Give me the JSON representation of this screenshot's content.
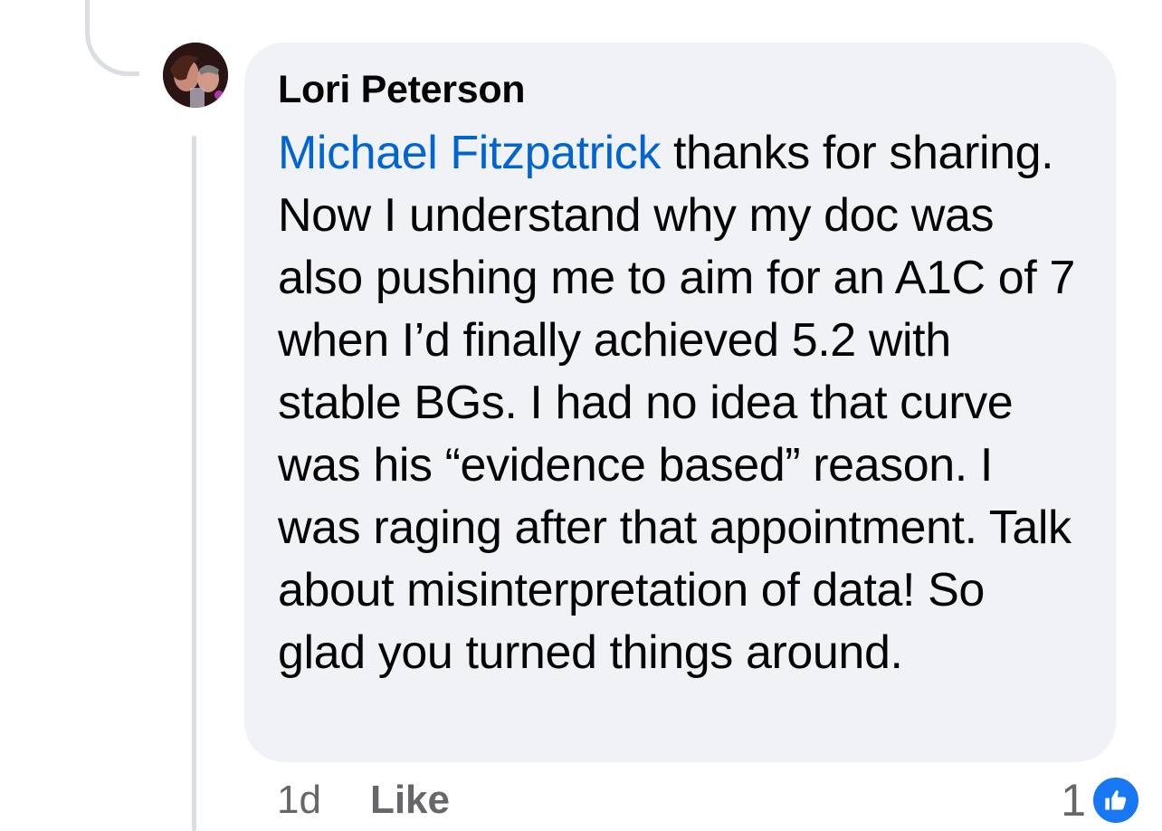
{
  "comment": {
    "author": "Lori Peterson",
    "mention": "Michael Fitzpatrick",
    "text": " thanks for sharing. Now I understand why my doc was also pushing me to aim for an A1C of 7 when I’d finally achieved 5.2 with stable BGs. I had no idea that curve was his “evidence based” reason. I was raging after that appointment. Talk about misinterpretation of data! So glad you turned things around.",
    "timestamp": "1d",
    "like_label": "Like",
    "reaction_count": "1",
    "reaction_icon": "like-thumbs-up-icon"
  },
  "colors": {
    "bubble": "#f0f2f5",
    "mention": "#0064d1",
    "meta": "#65676b",
    "like_blue": "#1877f2"
  }
}
